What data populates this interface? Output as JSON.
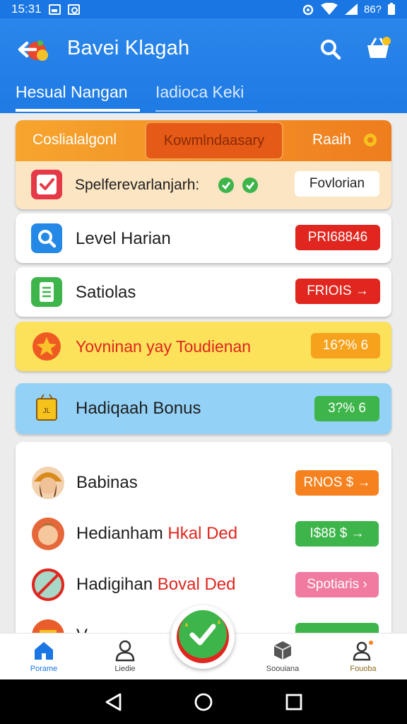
{
  "status_bar": {
    "time": "15:31",
    "battery": "86?"
  },
  "app_bar": {
    "title": "Bavei Klagah"
  },
  "tabs": [
    {
      "label": "Hesual Nangan"
    },
    {
      "label": "Iadioca Keki"
    }
  ],
  "top_card": {
    "header": {
      "left": "Coslialalgonl",
      "center": "Kowmlndaasary",
      "right": "Raaih"
    },
    "row": {
      "label": "Spelferevarlanjarh:",
      "button": "Fovlorian"
    }
  },
  "rows": [
    {
      "label": "Level Harian",
      "badge": "PRI68846",
      "badge_color": "#e0261e"
    },
    {
      "label": "Satiolas",
      "badge": "FRIOIS →",
      "badge_color": "#e0261e"
    },
    {
      "label": "Yovninan yay Toudienan",
      "badge": "16?% 6",
      "badge_color": "#f6a21c"
    },
    {
      "label": "Hadiqaah Bonus",
      "badge": "3?% 6",
      "badge_color": "#3db54a"
    }
  ],
  "list": [
    {
      "label": "Babinas",
      "label_red": "",
      "badge": "RNOS $ →",
      "badge_color": "#f5821f"
    },
    {
      "label": "Hedianham ",
      "label_red": "Hkal Ded",
      "badge": "I$88 $ →",
      "badge_color": "#3db54a"
    },
    {
      "label": "Hadigihan ",
      "label_red": "Boval Ded",
      "badge": "Spotiaris ›",
      "badge_color": "#f07aa0"
    },
    {
      "label": "V",
      "label_red": "",
      "badge": "",
      "badge_color": "#3db54a"
    }
  ],
  "bottom_nav": [
    {
      "label": "Porame",
      "color": "#1976e3"
    },
    {
      "label": "Liedie",
      "color": "#444444"
    },
    {
      "label": "Soouiana",
      "color": "#444444"
    },
    {
      "label": "Fouoba",
      "color": "#8a6a1a"
    }
  ],
  "colors": {
    "primary": "#1976e3",
    "accent_orange": "#ef7d1e",
    "red": "#e0261e",
    "green": "#3db54a"
  }
}
